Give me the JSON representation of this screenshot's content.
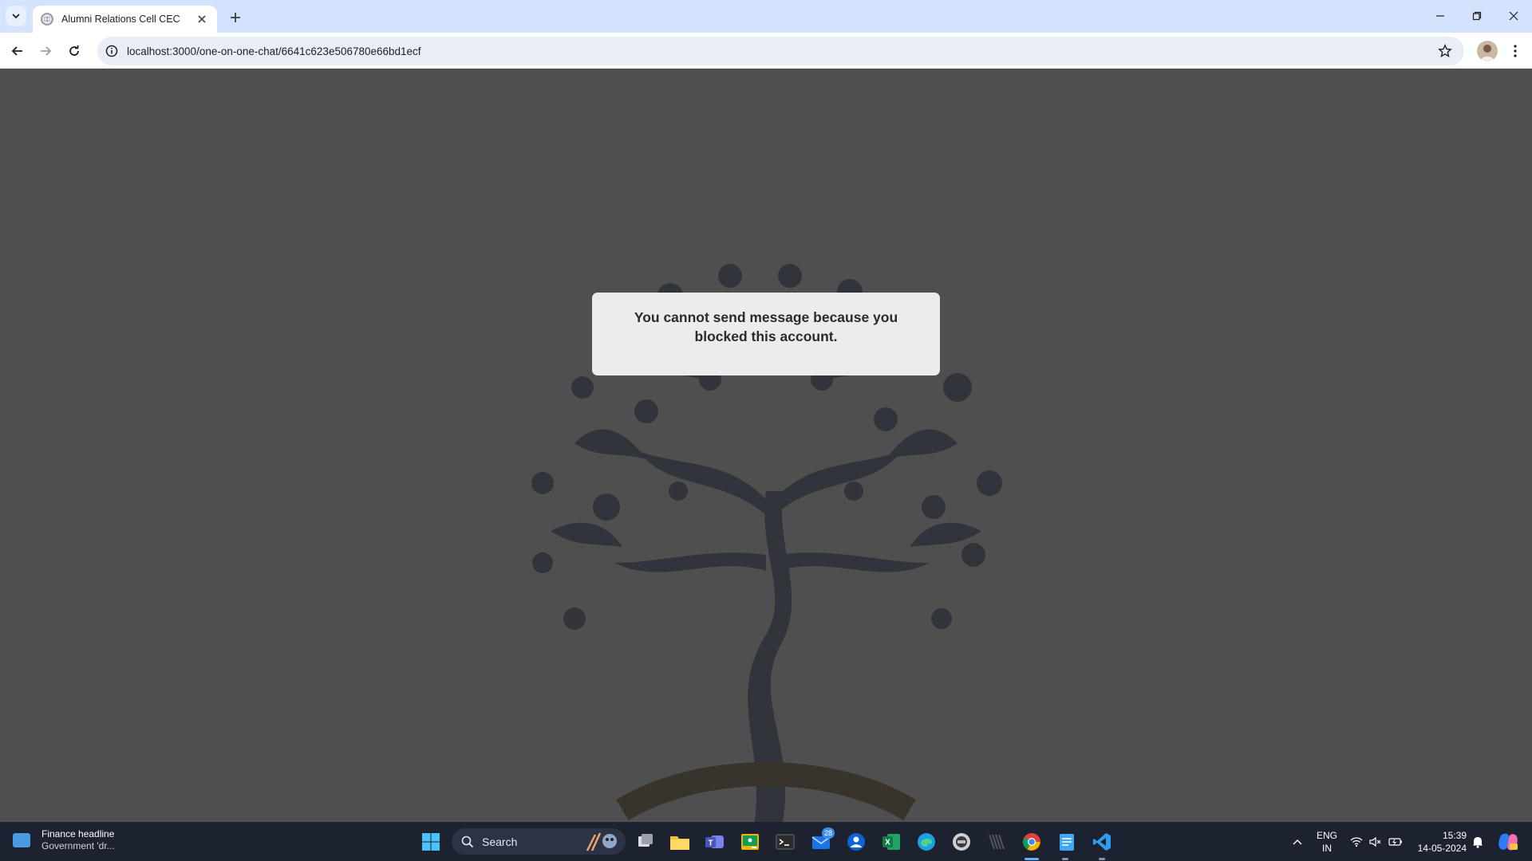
{
  "browser": {
    "tab": {
      "title": "Alumni Relations Cell CEC"
    },
    "address_bar": {
      "url": "localhost:3000/one-on-one-chat/6641c623e506780e66bd1ecf"
    }
  },
  "dialog": {
    "message": "You cannot send message because you blocked this account."
  },
  "taskbar": {
    "news": {
      "title": "Finance headline",
      "subtitle": "Government 'dr..."
    },
    "search": {
      "label": "Search"
    },
    "mail_badge": "28",
    "language": {
      "line1": "ENG",
      "line2": "IN"
    },
    "clock": {
      "time": "15:39",
      "date": "14-05-2024"
    }
  },
  "colors": {
    "tab_strip": "#d3e3fd",
    "overlay": "rgba(0,0,0,0.69)",
    "dialog": "#ececec",
    "taskbar": "#1c2230"
  }
}
